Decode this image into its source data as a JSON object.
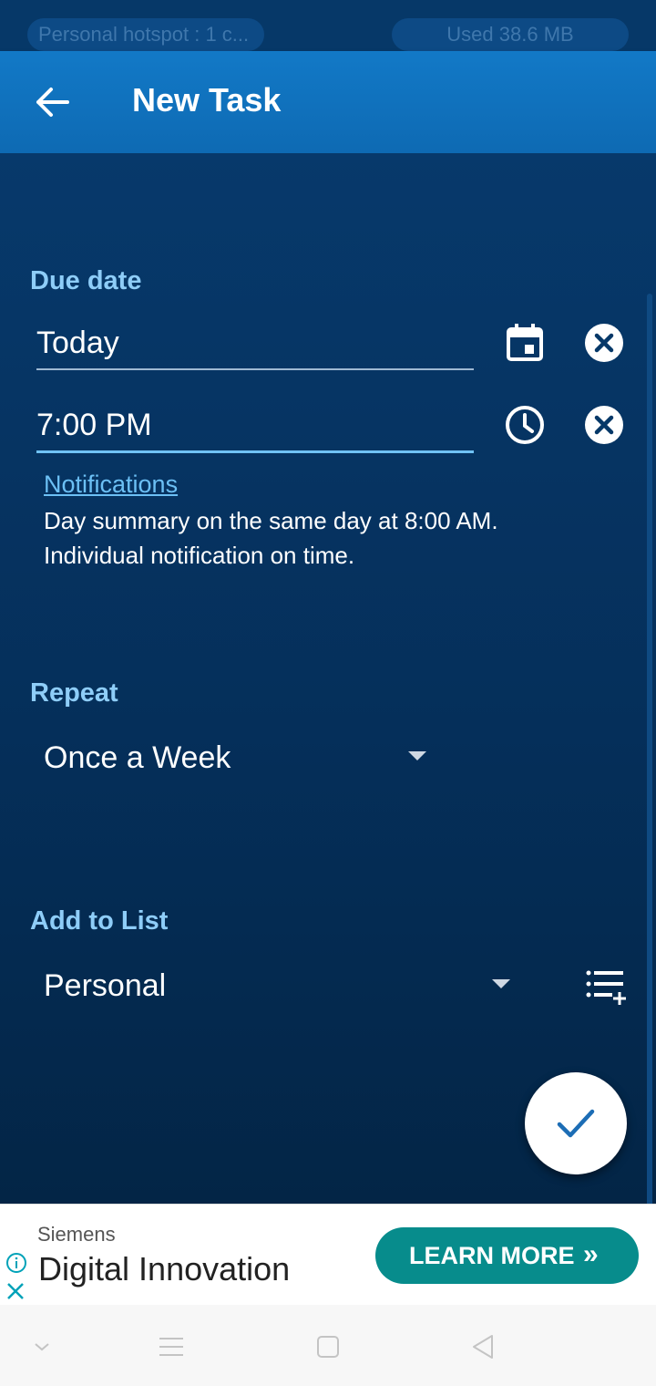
{
  "status_bar": {
    "hotspot": "Personal hotspot : 1 c...",
    "data_used": "Used  38.6 MB"
  },
  "app_bar": {
    "back_icon": "arrow-back-icon",
    "title": "New Task"
  },
  "due_date": {
    "label": "Due date",
    "date_value": "Today",
    "time_value": "7:00 PM",
    "calendar_icon": "calendar-icon",
    "clock_icon": "clock-icon",
    "clear_icon": "clear-circle-icon"
  },
  "notifications": {
    "link": "Notifications",
    "line1": "Day summary on the same day at 8:00 AM.",
    "line2": "Individual notification on time."
  },
  "repeat": {
    "label": "Repeat",
    "value": "Once a Week"
  },
  "list": {
    "label": "Add to List",
    "value": "Personal",
    "add_list_icon": "playlist-add-icon"
  },
  "fab": {
    "icon": "check-icon"
  },
  "ad": {
    "sponsor": "Siemens",
    "headline": "Digital Innovation",
    "cta": "LEARN MORE",
    "cta_chevron": "»"
  },
  "colors": {
    "accent": "#8ecdf8",
    "app_bar": "#1279c7",
    "background": "#07396b",
    "cta": "#078c8c"
  }
}
